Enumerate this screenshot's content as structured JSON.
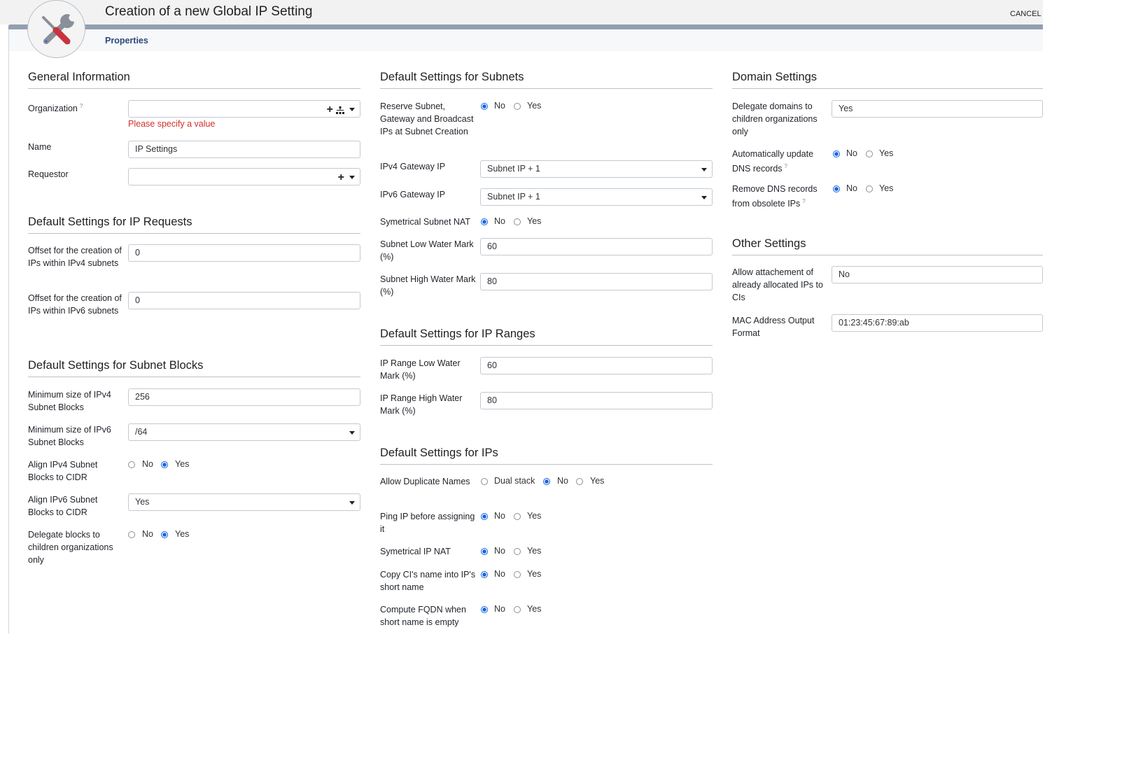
{
  "header": {
    "title": "Creation of a new Global IP Setting",
    "cancel_label": "CANCEL",
    "tab": "Properties",
    "logo_icon": "tools-icon"
  },
  "colors": {
    "accent": "#1565e0",
    "error": "#d0312d",
    "bar": "#919fb0",
    "logo_red": "#c8333d"
  },
  "columns": [
    [
      {
        "heading": "General Information",
        "fields": [
          {
            "label": "Organization",
            "help": "?",
            "type": "lookup",
            "value": "",
            "icons": [
              "plus-icon",
              "tree-icon"
            ],
            "error": "Please specify a value"
          },
          {
            "label": "Name",
            "type": "text",
            "value": "IP Settings"
          },
          {
            "label": "Requestor",
            "type": "lookup",
            "value": "",
            "icons": [
              "plus-icon"
            ]
          }
        ]
      },
      {
        "heading": "Default Settings for IP Requests",
        "fields": [
          {
            "label": "Offset for the creation of IPs within IPv4 subnets",
            "type": "text",
            "value": "0"
          },
          {
            "label": "Offset for the creation of IPs within IPv6 subnets",
            "type": "text",
            "value": "0"
          }
        ]
      },
      {
        "heading": "Default Settings for Subnet Blocks",
        "fields": [
          {
            "label": "Minimum size of IPv4 Subnet Blocks",
            "type": "text",
            "value": "256"
          },
          {
            "label": "Minimum size of IPv6 Subnet Blocks",
            "type": "select",
            "value": "/64"
          },
          {
            "label": "Align IPv4 Subnet Blocks to CIDR",
            "type": "radio",
            "options": [
              "No",
              "Yes"
            ],
            "selected": "Yes"
          },
          {
            "label": "Align IPv6 Subnet Blocks to CIDR",
            "type": "select",
            "value": "Yes"
          },
          {
            "label": "Delegate blocks to children organizations only",
            "type": "radio",
            "options": [
              "No",
              "Yes"
            ],
            "selected": "Yes"
          }
        ]
      }
    ],
    [
      {
        "heading": "Default Settings for Subnets",
        "fields": [
          {
            "label": "Reserve Subnet, Gateway and Broadcast IPs at Subnet Creation",
            "type": "radio",
            "options": [
              "No",
              "Yes"
            ],
            "selected": "No"
          },
          {
            "label": "IPv4 Gateway IP",
            "type": "select",
            "value": "Subnet IP + 1"
          },
          {
            "label": "IPv6 Gateway IP",
            "type": "select",
            "value": "Subnet IP + 1"
          },
          {
            "label": "Symetrical Subnet NAT",
            "type": "radio",
            "options": [
              "No",
              "Yes"
            ],
            "selected": "No"
          },
          {
            "label": "Subnet Low Water Mark (%)",
            "type": "text",
            "value": "60"
          },
          {
            "label": "Subnet High Water Mark (%)",
            "type": "text",
            "value": "80"
          }
        ]
      },
      {
        "heading": "Default Settings for IP Ranges",
        "fields": [
          {
            "label": "IP Range Low Water Mark (%)",
            "type": "text",
            "value": "60"
          },
          {
            "label": "IP Range High Water Mark (%)",
            "type": "text",
            "value": "80"
          }
        ]
      },
      {
        "heading": "Default Settings for IPs",
        "fields": [
          {
            "label": "Allow Duplicate Names",
            "type": "radio",
            "options": [
              "Dual stack",
              "No",
              "Yes"
            ],
            "selected": "No"
          },
          {
            "label": "Ping IP before assigning it",
            "type": "radio",
            "options": [
              "No",
              "Yes"
            ],
            "selected": "No"
          },
          {
            "label": "Symetrical IP NAT",
            "type": "radio",
            "options": [
              "No",
              "Yes"
            ],
            "selected": "No"
          },
          {
            "label": "Copy CI's name into IP's short name",
            "type": "radio",
            "options": [
              "No",
              "Yes"
            ],
            "selected": "No"
          },
          {
            "label": "Compute FQDN when short name is empty",
            "type": "radio",
            "options": [
              "No",
              "Yes"
            ],
            "selected": "No"
          }
        ]
      }
    ],
    [
      {
        "heading": "Domain Settings",
        "fields": [
          {
            "label": "Delegate domains to children organizations only",
            "type": "text",
            "value": "Yes"
          },
          {
            "label": "Automatically update DNS records",
            "help": "?",
            "type": "radio",
            "options": [
              "No",
              "Yes"
            ],
            "selected": "No"
          },
          {
            "label": "Remove DNS records from obsolete IPs",
            "help": "?",
            "type": "radio",
            "options": [
              "No",
              "Yes"
            ],
            "selected": "No"
          }
        ]
      },
      {
        "heading": "Other Settings",
        "fields": [
          {
            "label": "Allow attachement of already allocated IPs to CIs",
            "type": "text",
            "value": "No"
          },
          {
            "label": "MAC Address Output Format",
            "type": "text",
            "value": "01:23:45:67:89:ab"
          }
        ]
      }
    ]
  ]
}
